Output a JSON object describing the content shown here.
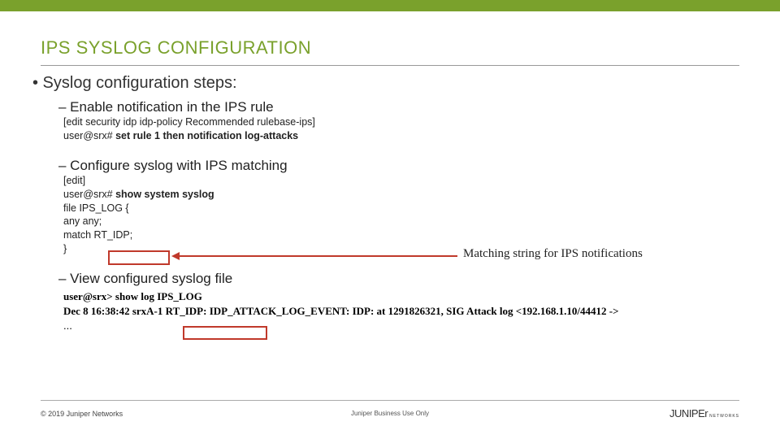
{
  "title": "IPS SYSLOG CONFIGURATION",
  "main_bullet": "• Syslog configuration steps:",
  "sub1": "– Enable notification in the IPS rule",
  "code1_line1": "[edit security idp idp-policy Recommended rulebase-ips]",
  "code1_prompt": " user@srx# ",
  "code1_cmd": "set rule 1 then notification log-attacks",
  "sub2": "– Configure syslog with IPS matching",
  "code2_l1": "[edit]",
  "code2_l2a": "user@srx# ",
  "code2_l2b": "show system syslog",
  "code2_l3": "file IPS_LOG {",
  "code2_l4": "    any any;",
  "code2_l5": "    match RT_IDP;",
  "code2_l6": "}",
  "annotation": "Matching string for IPS notifications",
  "sub3": "– View configured syslog file",
  "log_cmd": "user@srx> show log IPS_LOG",
  "log_line": "Dec  8 16:38:42  srxA-1 RT_IDP: IDP_ATTACK_LOG_EVENT: IDP: at 1291826321, SIG Attack log <192.168.1.10/44412 ->",
  "ellipsis": "...",
  "footer_left": "© 2019 Juniper Networks",
  "footer_center": "Juniper Business Use Only",
  "footer_logo": "JUNIPEr",
  "footer_logo_sub": "NETWORKS"
}
